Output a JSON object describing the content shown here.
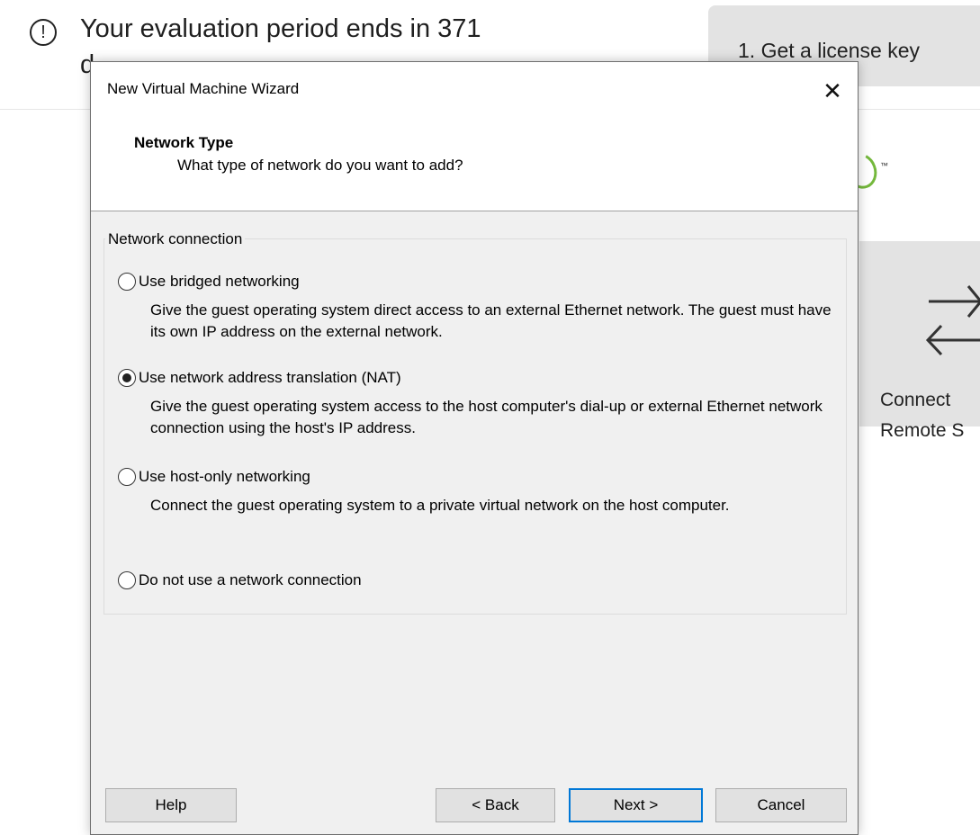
{
  "background": {
    "banner_text": "Your evaluation period ends in 371",
    "banner_text_cont": "d",
    "license_button": "1. Get a license key",
    "logo_tm": "™",
    "remote_card_label": "Connect\nRemote S"
  },
  "dialog": {
    "title": "New Virtual Machine Wizard",
    "close_glyph": "✕",
    "step_title": "Network Type",
    "step_subtitle": "What type of network do you want to add?",
    "group_label": "Network connection",
    "options": [
      {
        "label": "Use bridged networking",
        "description": "Give the guest operating system direct access to an external Ethernet network. The guest must have its own IP address on the external network.",
        "selected": false
      },
      {
        "label": "Use network address translation (NAT)",
        "description": "Give the guest operating system access to the host computer's dial-up or external Ethernet network connection using the host's IP address.",
        "selected": true
      },
      {
        "label": "Use host-only networking",
        "description": "Connect the guest operating system to a private virtual network on the host computer.",
        "selected": false
      },
      {
        "label": "Do not use a network connection",
        "description": "",
        "selected": false
      }
    ],
    "buttons": {
      "help": "Help",
      "back": "< Back",
      "next": "Next >",
      "cancel": "Cancel"
    }
  },
  "colors": {
    "dialog_bg": "#f0f0f0",
    "default_button_border": "#0078d7",
    "card_bg": "#e3e3e3",
    "logo_green": "#74b83c"
  }
}
